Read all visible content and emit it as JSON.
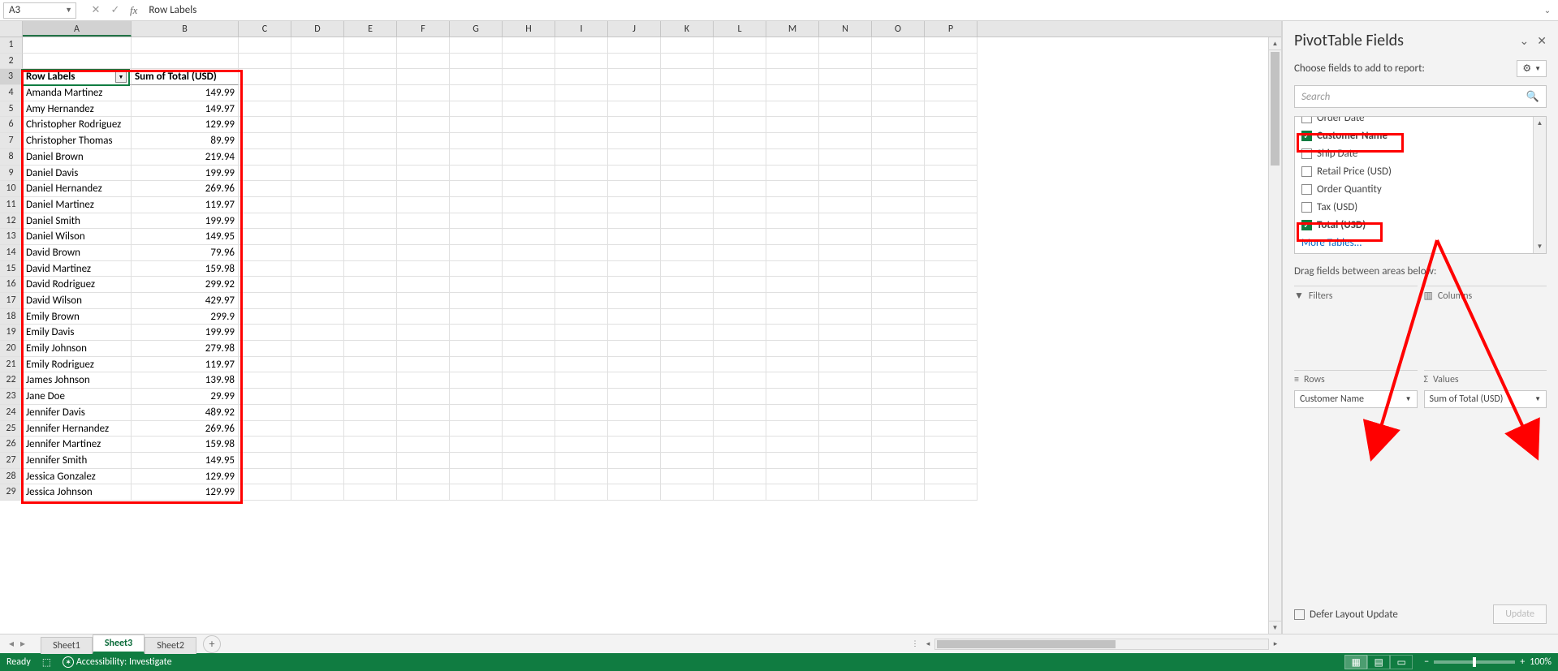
{
  "formula_bar": {
    "cell_ref": "A3",
    "content": "Row Labels"
  },
  "columns": [
    "A",
    "B",
    "C",
    "D",
    "E",
    "F",
    "G",
    "H",
    "I",
    "J",
    "K",
    "L",
    "M",
    "N",
    "O",
    "P"
  ],
  "col_widths": {
    "A": 134,
    "B": 132,
    "default": 65
  },
  "pivot": {
    "header_row_labels": "Row Labels",
    "header_sum": "Sum of Total (USD)",
    "rows": [
      {
        "name": "Amanda Martinez",
        "val": "149.99"
      },
      {
        "name": "Amy Hernandez",
        "val": "149.97"
      },
      {
        "name": "Christopher Rodriguez",
        "val": "129.99"
      },
      {
        "name": "Christopher Thomas",
        "val": "89.99"
      },
      {
        "name": "Daniel Brown",
        "val": "219.94"
      },
      {
        "name": "Daniel Davis",
        "val": "199.99"
      },
      {
        "name": "Daniel Hernandez",
        "val": "269.96"
      },
      {
        "name": "Daniel Martinez",
        "val": "119.97"
      },
      {
        "name": "Daniel Smith",
        "val": "199.99"
      },
      {
        "name": "Daniel Wilson",
        "val": "149.95"
      },
      {
        "name": "David Brown",
        "val": "79.96"
      },
      {
        "name": "David Martinez",
        "val": "159.98"
      },
      {
        "name": "David Rodriguez",
        "val": "299.92"
      },
      {
        "name": "David Wilson",
        "val": "429.97"
      },
      {
        "name": "Emily Brown",
        "val": "299.9"
      },
      {
        "name": "Emily Davis",
        "val": "199.99"
      },
      {
        "name": "Emily Johnson",
        "val": "279.98"
      },
      {
        "name": "Emily Rodriguez",
        "val": "119.97"
      },
      {
        "name": "James Johnson",
        "val": "139.98"
      },
      {
        "name": "Jane Doe",
        "val": "29.99"
      },
      {
        "name": "Jennifer Davis",
        "val": "489.92"
      },
      {
        "name": "Jennifer Hernandez",
        "val": "269.96"
      },
      {
        "name": "Jennifer Martinez",
        "val": "159.98"
      },
      {
        "name": "Jennifer Smith",
        "val": "149.95"
      },
      {
        "name": "Jessica Gonzalez",
        "val": "129.99"
      },
      {
        "name": "Jessica Johnson",
        "val": "129.99"
      }
    ]
  },
  "pivot_pane": {
    "title": "PivotTable Fields",
    "subtitle": "Choose fields to add to report:",
    "search_placeholder": "Search",
    "fields": [
      {
        "label": "Order Date",
        "checked": false,
        "bold": false,
        "partial": true
      },
      {
        "label": "Customer Name",
        "checked": true,
        "bold": true
      },
      {
        "label": "Ship Date",
        "checked": false,
        "bold": false
      },
      {
        "label": "Retail Price (USD)",
        "checked": false,
        "bold": false
      },
      {
        "label": "Order Quantity",
        "checked": false,
        "bold": false
      },
      {
        "label": "Tax (USD)",
        "checked": false,
        "bold": false
      },
      {
        "label": "Total (USD)",
        "checked": true,
        "bold": true
      }
    ],
    "more_tables": "More Tables...",
    "drag_label": "Drag fields between areas below:",
    "filters_label": "Filters",
    "columns_label": "Columns",
    "rows_label": "Rows",
    "values_label": "Values",
    "rows_field": "Customer Name",
    "values_field": "Sum of Total (USD)",
    "defer_label": "Defer Layout Update",
    "update_label": "Update"
  },
  "sheets": {
    "tabs": [
      "Sheet1",
      "Sheet3",
      "Sheet2"
    ],
    "active": "Sheet3"
  },
  "status": {
    "ready": "Ready",
    "accessibility": "Accessibility: Investigate",
    "zoom": "100%"
  }
}
